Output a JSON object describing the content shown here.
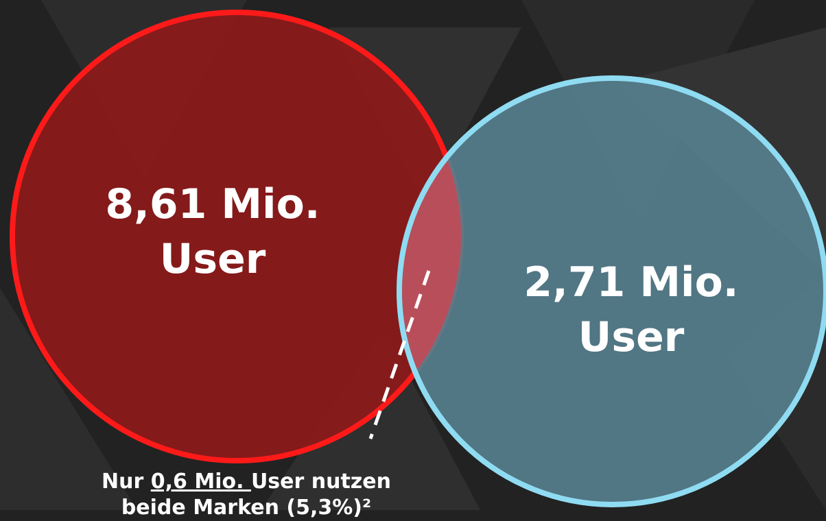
{
  "diagram": {
    "type": "venn",
    "colors": {
      "background": "#222222",
      "left_fill": "#8e1a1a",
      "left_stroke": "#ff1a1a",
      "right_fill": "#56808f",
      "right_stroke": "#8fdcf2",
      "overlap_fill": "#c24a55"
    },
    "left_circle": {
      "value_line": "8,61 Mio.",
      "unit_line": "User"
    },
    "right_circle": {
      "value_line": "2,71 Mio.",
      "unit_line": "User"
    },
    "overlap_note": {
      "prefix": "Nur ",
      "highlight": "0,6 Mio. ",
      "suffix": "User nutzen",
      "line2": "beide Marken (5,3%)²"
    }
  }
}
